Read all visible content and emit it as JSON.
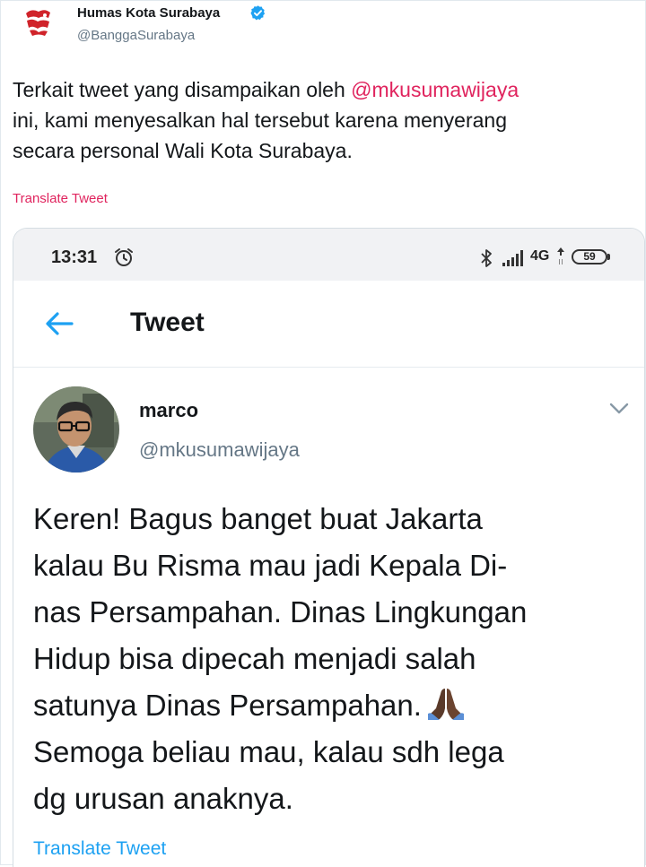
{
  "author": {
    "name": "Humas Kota Surabaya",
    "handle": "@BanggaSurabaya",
    "verified": true
  },
  "tweet": {
    "prefix": "Terkait tweet yang disampaikan oleh ",
    "mention": "@mkusumawijaya",
    "line2": "ini, kami menyesalkan hal tersebut karena menyerang",
    "line3": "secara personal Wali Kota Surabaya.",
    "translate_label": "Translate Tweet"
  },
  "embedded": {
    "status_bar": {
      "time": "13:31",
      "network": "4G",
      "battery": "59"
    },
    "header": {
      "title": "Tweet"
    },
    "tweet": {
      "name": "marco",
      "handle": "@mkusumawijaya",
      "lines": [
        "Keren! Bagus banget buat Jakarta",
        "kalau Bu Risma mau jadi Kepala Di-",
        "nas Persampahan. Dinas Lingkungan",
        "Hidup bisa dipecah menjadi salah",
        "satunya Dinas Persampahan.",
        "Semoga beliau mau, kalau sdh lega",
        "dg urusan anaknya."
      ],
      "translate_label": "Translate Tweet"
    }
  },
  "colors": {
    "accent_pink": "#e0245e",
    "twitter_blue": "#1da1f2",
    "secondary_text": "#657786"
  },
  "icons": [
    "surabaya-logo-icon",
    "verified-icon",
    "alarm-icon",
    "bluetooth-icon",
    "signal-icon",
    "back-arrow-icon",
    "chevron-down-icon",
    "folded-hands-icon"
  ]
}
